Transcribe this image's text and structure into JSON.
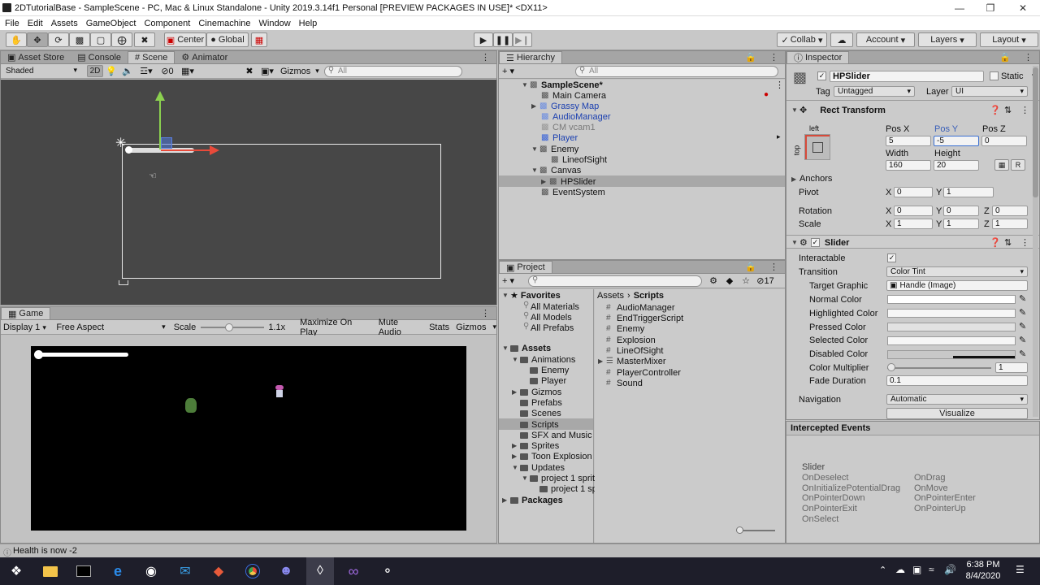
{
  "window": {
    "title": "2DTutorialBase - SampleScene - PC, Mac & Linux Standalone - Unity 2019.3.14f1 Personal [PREVIEW PACKAGES IN USE]* <DX11>"
  },
  "menu": [
    "File",
    "Edit",
    "Assets",
    "GameObject",
    "Component",
    "Cinemachine",
    "Window",
    "Help"
  ],
  "toolbar": {
    "center_label": "Center",
    "global_label": "Global",
    "collab_label": "Collab",
    "account_label": "Account",
    "layers_label": "Layers",
    "layout_label": "Layout"
  },
  "tabs": {
    "asset_store": "Asset Store",
    "console": "Console",
    "scene": "Scene",
    "animator": "Animator",
    "hierarchy": "Hierarchy",
    "inspector": "Inspector",
    "game": "Game",
    "project": "Project"
  },
  "scene": {
    "shading": "Shaded",
    "mode_2d": "2D",
    "hidden_count": "0",
    "gizmos": "Gizmos",
    "search_placeholder": "All"
  },
  "game": {
    "display": "Display 1",
    "aspect": "Free Aspect",
    "scale_label": "Scale",
    "scale_value": "1.1x",
    "maximize": "Maximize On Play",
    "mute": "Mute Audio",
    "stats": "Stats",
    "gizmos": "Gizmos"
  },
  "hierarchy": {
    "search_placeholder": "All",
    "items": [
      {
        "label": "SampleScene*",
        "type": "scene"
      },
      {
        "label": "Main Camera",
        "type": "normal"
      },
      {
        "label": "Grassy Map",
        "type": "prefab"
      },
      {
        "label": "AudioManager",
        "type": "prefab"
      },
      {
        "label": "CM vcam1",
        "type": "inactive"
      },
      {
        "label": "Player",
        "type": "prefab"
      },
      {
        "label": "Enemy",
        "type": "normal"
      },
      {
        "label": "LineofSight",
        "type": "normal"
      },
      {
        "label": "Canvas",
        "type": "normal"
      },
      {
        "label": "HPSlider",
        "type": "selected"
      },
      {
        "label": "EventSystem",
        "type": "normal"
      }
    ]
  },
  "project": {
    "breadcrumb_root": "Assets",
    "breadcrumb_current": "Scripts",
    "hidden_count": "17",
    "tree": [
      {
        "label": "Favorites",
        "bold": true
      },
      {
        "label": "All Materials"
      },
      {
        "label": "All Models"
      },
      {
        "label": "All Prefabs"
      },
      {
        "label": "Assets",
        "bold": true
      },
      {
        "label": "Animations"
      },
      {
        "label": "Enemy"
      },
      {
        "label": "Player"
      },
      {
        "label": "Gizmos"
      },
      {
        "label": "Prefabs"
      },
      {
        "label": "Scenes"
      },
      {
        "label": "Scripts"
      },
      {
        "label": "SFX and Music"
      },
      {
        "label": "Sprites"
      },
      {
        "label": "Toon Explosion"
      },
      {
        "label": "Updates"
      },
      {
        "label": "project 1 sprit"
      },
      {
        "label": "project 1 sp"
      },
      {
        "label": "Packages",
        "bold": true
      }
    ],
    "files": [
      "AudioManager",
      "EndTriggerScript",
      "Enemy",
      "Explosion",
      "LineOfSight",
      "MasterMixer",
      "PlayerController",
      "Sound"
    ]
  },
  "inspector": {
    "object_name": "HPSlider",
    "static_label": "Static",
    "tag_label": "Tag",
    "tag_value": "Untagged",
    "layer_label": "Layer",
    "layer_value": "UI",
    "rect_transform": "Rect Transform",
    "anchor_h": "left",
    "anchor_v": "top",
    "pos_x_label": "Pos X",
    "pos_y_label": "Pos Y",
    "pos_z_label": "Pos Z",
    "pos_x": "5",
    "pos_y": "-5",
    "pos_z": "0",
    "width_label": "Width",
    "height_label": "Height",
    "width": "160",
    "height": "20",
    "r_button": "R",
    "anchors_label": "Anchors",
    "pivot_label": "Pivot",
    "pivot_x": "0",
    "pivot_y": "1",
    "rotation_label": "Rotation",
    "rot_x": "0",
    "rot_y": "0",
    "rot_z": "0",
    "scale_label": "Scale",
    "scale_x": "1",
    "scale_y": "1",
    "scale_z": "1",
    "axis_x": "X",
    "axis_y": "Y",
    "axis_z": "Z",
    "slider_label": "Slider",
    "interactable_label": "Interactable",
    "transition_label": "Transition",
    "transition_value": "Color Tint",
    "target_graphic_label": "Target Graphic",
    "target_graphic_value": "Handle (Image)",
    "normal_color_label": "Normal Color",
    "highlighted_color_label": "Highlighted Color",
    "pressed_color_label": "Pressed Color",
    "selected_color_label": "Selected Color",
    "disabled_color_label": "Disabled Color",
    "color_multiplier_label": "Color Multiplier",
    "color_multiplier_value": "1",
    "fade_duration_label": "Fade Duration",
    "fade_duration_value": "0.1",
    "navigation_label": "Navigation",
    "navigation_value": "Automatic",
    "visualize_label": "Visualize"
  },
  "events": {
    "title": "Intercepted Events",
    "header": "Slider",
    "left": [
      "OnDeselect",
      "OnInitializePotentialDrag",
      "OnPointerDown",
      "OnPointerExit",
      "OnSelect"
    ],
    "right": [
      "OnDrag",
      "OnMove",
      "OnPointerEnter",
      "OnPointerUp"
    ]
  },
  "status": {
    "message": "Health is now -2"
  },
  "taskbar": {
    "time": "6:38 PM",
    "date": "8/4/2020"
  }
}
